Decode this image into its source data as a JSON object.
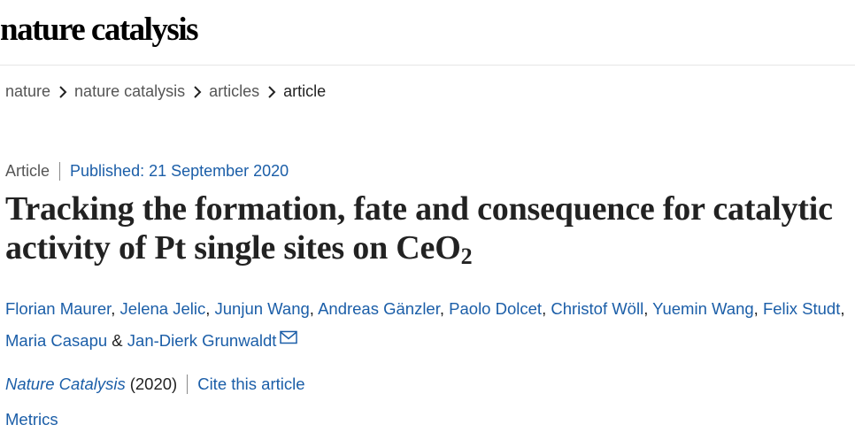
{
  "header": {
    "logo_text": "nature catalysis"
  },
  "breadcrumb": {
    "items": [
      "nature",
      "nature catalysis",
      "articles"
    ],
    "current": "article"
  },
  "article": {
    "type": "Article",
    "published": "Published: 21 September 2020",
    "title_main": "Tracking the formation, fate and consequence for catalytic activity of Pt single sites on CeO",
    "title_sub": "2",
    "authors": [
      "Florian Maurer",
      "Jelena Jelic",
      "Junjun Wang",
      "Andreas Gänzler",
      "Paolo Dolcet",
      "Christof Wöll",
      "Yuemin Wang",
      "Felix Studt",
      "Maria Casapu"
    ],
    "authors_separator": ", ",
    "authors_final_sep": " & ",
    "last_author": "Jan-Dierk Grunwaldt",
    "journal": "Nature Catalysis",
    "year": "(2020)",
    "cite_label": "Cite this article",
    "metrics_label": "Metrics"
  },
  "colors": {
    "link": "#1b5ea8",
    "text": "#222222",
    "muted": "#555555"
  },
  "icons": {
    "breadcrumb_separator": "chevron-right-icon",
    "corresponding_author": "envelope-icon"
  }
}
